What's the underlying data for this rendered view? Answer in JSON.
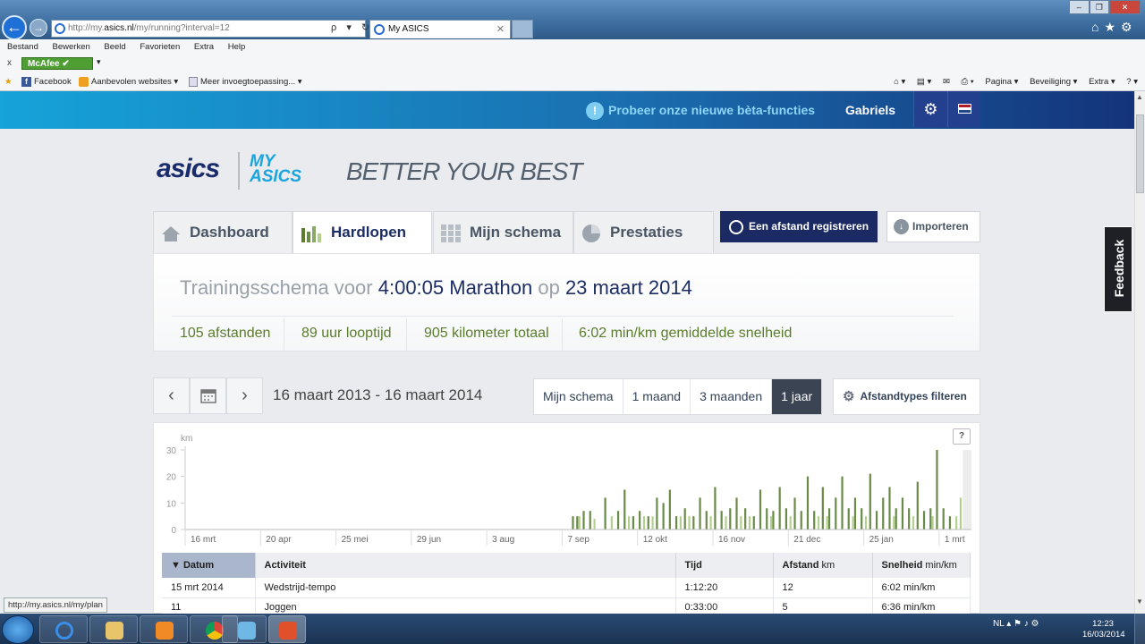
{
  "browser": {
    "url_prefix": "http://my.",
    "url_domain": "asics.nl",
    "url_path": "/my/running?interval=12",
    "address_actions": "ρ ▾ ↻",
    "tab_title": "My ASICS",
    "tab_close": "✕",
    "window_buttons": [
      "‒",
      "❐",
      "✕"
    ],
    "nav_icons": "⌂★⚙",
    "menu": [
      "Bestand",
      "Bewerken",
      "Beeld",
      "Favorieten",
      "Extra",
      "Help"
    ],
    "mcafee_close": "x",
    "mcafee_label": "McAfee",
    "mcafee_arrow": "▾",
    "favorites": [
      {
        "label": "Facebook",
        "icon": "f"
      },
      {
        "label": "Aanbevolen websites ▾"
      },
      {
        "label": "Meer invoegtoepassing... ▾"
      }
    ],
    "command_bar": [
      "⌂ ▾",
      "▤ ▾",
      "✉",
      "⎙ ▾",
      "Pagina ▾",
      "Beveiliging ▾",
      "Extra ▾",
      "? ▾"
    ],
    "status_url": "http://my.asics.nl/my/plan"
  },
  "site_header": {
    "beta_icon": "!",
    "beta_text": "Probeer onze nieuwe bèta-functies",
    "user_name": "Gabriels",
    "settings_icon": "⚙",
    "flag_colors": [
      "#ae1c28",
      "#ffffff",
      "#21468b"
    ]
  },
  "brand": {
    "logo": "asics",
    "sub1": "MY",
    "sub2": "ASICS",
    "tagline": "BETTER YOUR BEST"
  },
  "nav": {
    "tabs": [
      {
        "label": "Dashboard",
        "icon": "home-icon"
      },
      {
        "label": "Hardlopen",
        "icon": "bars-icon",
        "active": true
      },
      {
        "label": "Mijn schema",
        "icon": "grid-icon"
      },
      {
        "label": "Prestaties",
        "icon": "pie-icon"
      }
    ],
    "register_button": "Een afstand registreren",
    "import_button": "Importeren",
    "import_icon": "↓"
  },
  "plan": {
    "prefix": "Trainingsschema voor",
    "goal": "4:00:05 Marathon",
    "on": "op",
    "date": "23 maart 2014",
    "stats": [
      "105 afstanden",
      "89 uur looptijd",
      "905 kilometer totaal",
      "6:02 min/km gemiddelde snelheid"
    ]
  },
  "date_nav": {
    "prev": "‹",
    "calendar_icon": "calendar-icon",
    "next": "›",
    "range": "16 maart 2013 - 16 maart 2014"
  },
  "period": {
    "options": [
      "Mijn schema",
      "1 maand",
      "3 maanden",
      "1 jaar"
    ],
    "selected": "1 jaar"
  },
  "filter_button": "Afstandtypes filteren",
  "help_button": "?",
  "chart_data": {
    "type": "bar",
    "ylabel": "km",
    "ylim": [
      0,
      30
    ],
    "yticks": [
      0,
      10,
      20,
      30
    ],
    "x_tick_labels": [
      "16 mrt",
      "20 apr",
      "25 mei",
      "29 jun",
      "3 aug",
      "7 sep",
      "12 okt",
      "16 nov",
      "21 dec",
      "25 jan",
      "1 mrt"
    ],
    "x_tick_days": [
      0,
      35,
      70,
      105,
      140,
      175,
      210,
      245,
      280,
      315,
      350
    ],
    "colors": {
      "done": "#6a8a48",
      "planned": "#b4d08e",
      "future": "#d2e4b6"
    },
    "done": [
      {
        "day": 180,
        "km": 5
      },
      {
        "day": 182,
        "km": 5
      },
      {
        "day": 185,
        "km": 7
      },
      {
        "day": 188,
        "km": 7
      },
      {
        "day": 195,
        "km": 12
      },
      {
        "day": 201,
        "km": 7
      },
      {
        "day": 204,
        "km": 15
      },
      {
        "day": 208,
        "km": 5
      },
      {
        "day": 211,
        "km": 7
      },
      {
        "day": 215,
        "km": 5
      },
      {
        "day": 219,
        "km": 12
      },
      {
        "day": 222,
        "km": 10
      },
      {
        "day": 225,
        "km": 15
      },
      {
        "day": 228,
        "km": 5
      },
      {
        "day": 232,
        "km": 8
      },
      {
        "day": 236,
        "km": 5
      },
      {
        "day": 239,
        "km": 12
      },
      {
        "day": 242,
        "km": 7
      },
      {
        "day": 246,
        "km": 16
      },
      {
        "day": 249,
        "km": 7
      },
      {
        "day": 253,
        "km": 8
      },
      {
        "day": 256,
        "km": 12
      },
      {
        "day": 260,
        "km": 8
      },
      {
        "day": 264,
        "km": 5
      },
      {
        "day": 267,
        "km": 15
      },
      {
        "day": 270,
        "km": 8
      },
      {
        "day": 273,
        "km": 7
      },
      {
        "day": 276,
        "km": 16
      },
      {
        "day": 279,
        "km": 8
      },
      {
        "day": 283,
        "km": 12
      },
      {
        "day": 286,
        "km": 7
      },
      {
        "day": 289,
        "km": 20
      },
      {
        "day": 292,
        "km": 7
      },
      {
        "day": 296,
        "km": 16
      },
      {
        "day": 299,
        "km": 8
      },
      {
        "day": 302,
        "km": 12
      },
      {
        "day": 305,
        "km": 20
      },
      {
        "day": 308,
        "km": 8
      },
      {
        "day": 311,
        "km": 12
      },
      {
        "day": 314,
        "km": 8
      },
      {
        "day": 318,
        "km": 21
      },
      {
        "day": 321,
        "km": 7
      },
      {
        "day": 324,
        "km": 12
      },
      {
        "day": 327,
        "km": 16
      },
      {
        "day": 330,
        "km": 8
      },
      {
        "day": 333,
        "km": 12
      },
      {
        "day": 336,
        "km": 8
      },
      {
        "day": 340,
        "km": 18
      },
      {
        "day": 343,
        "km": 7
      },
      {
        "day": 346,
        "km": 8
      },
      {
        "day": 349,
        "km": 30
      },
      {
        "day": 352,
        "km": 8
      },
      {
        "day": 355,
        "km": 5
      }
    ],
    "planned": [
      {
        "day": 183,
        "km": 5
      },
      {
        "day": 190,
        "km": 4
      },
      {
        "day": 198,
        "km": 5
      },
      {
        "day": 206,
        "km": 5
      },
      {
        "day": 213,
        "km": 5
      },
      {
        "day": 217,
        "km": 5
      },
      {
        "day": 230,
        "km": 5
      },
      {
        "day": 234,
        "km": 5
      },
      {
        "day": 244,
        "km": 5
      },
      {
        "day": 251,
        "km": 5
      },
      {
        "day": 258,
        "km": 5
      },
      {
        "day": 262,
        "km": 5
      },
      {
        "day": 272,
        "km": 5
      },
      {
        "day": 281,
        "km": 5
      },
      {
        "day": 294,
        "km": 5
      },
      {
        "day": 298,
        "km": 5
      },
      {
        "day": 310,
        "km": 5
      },
      {
        "day": 316,
        "km": 5
      },
      {
        "day": 329,
        "km": 5
      },
      {
        "day": 338,
        "km": 5
      },
      {
        "day": 347,
        "km": 5
      },
      {
        "day": 358,
        "km": 5
      },
      {
        "day": 360,
        "km": 12
      }
    ],
    "future_shaded_from_day": 361
  },
  "table": {
    "headers": [
      {
        "label": "Datum",
        "unit": "",
        "sorted": true
      },
      {
        "label": "Activiteit",
        "unit": ""
      },
      {
        "label": "Tijd",
        "unit": ""
      },
      {
        "label": "Afstand",
        "unit": "km"
      },
      {
        "label": "Snelheid",
        "unit": "min/km"
      }
    ],
    "sort_indicator": "▼",
    "rows": [
      [
        "15 mrt 2014",
        "Wedstrijd-tempo",
        "1:12:20",
        "12",
        "6:02 min/km"
      ],
      [
        "11",
        "Joggen",
        "0:33:00",
        "5",
        "6:36 min/km"
      ]
    ]
  },
  "feedback_label": "Feedback",
  "taskbar": {
    "tray": "NL ▴ ⚑ ♪ ⚙",
    "time": "12:23",
    "date": "16/03/2014"
  }
}
